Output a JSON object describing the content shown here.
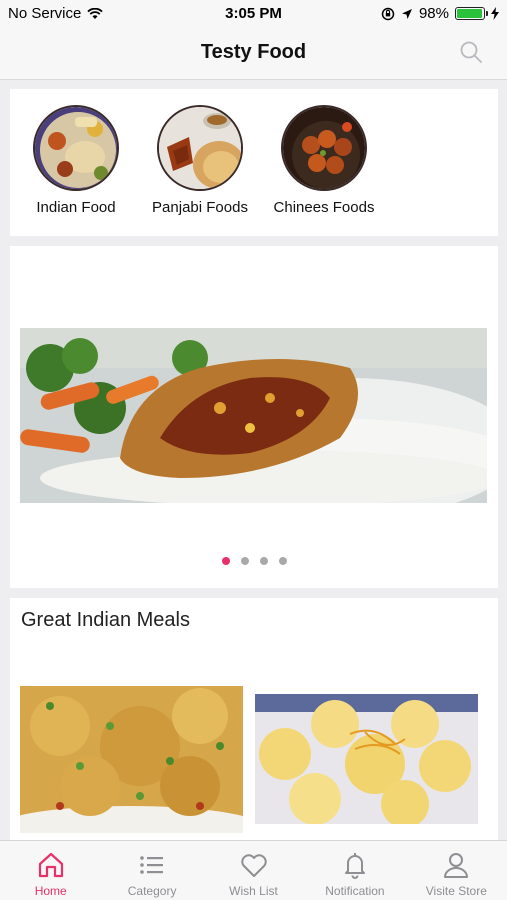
{
  "status_bar": {
    "carrier": "No Service",
    "time": "3:05 PM",
    "battery": "98%",
    "battery_level": 0.98
  },
  "header": {
    "title": "Testy Food",
    "search_icon": "search-icon"
  },
  "categories": [
    {
      "label": "Indian Food",
      "image": "indian-thali-image"
    },
    {
      "label": "Panjabi Foods",
      "image": "panjabi-food-image"
    },
    {
      "label": "Chinees Foods",
      "image": "chinese-food-image"
    }
  ],
  "banner": {
    "image": "chicken-rice-banner-image",
    "page_count": 4,
    "active_page": 1
  },
  "section": {
    "title": "Great Indian Meals",
    "items": [
      {
        "image": "vegetable-poha-image"
      },
      {
        "image": "rasgulla-sweets-image"
      }
    ]
  },
  "tabs": [
    {
      "label": "Home",
      "icon": "home-icon",
      "active": true
    },
    {
      "label": "Category",
      "icon": "list-icon",
      "active": false
    },
    {
      "label": "Wish List",
      "icon": "heart-icon",
      "active": false
    },
    {
      "label": "Notification",
      "icon": "bell-icon",
      "active": false
    },
    {
      "label": "Visite Store",
      "icon": "person-icon",
      "active": false
    }
  ],
  "colors": {
    "accent": "#e8316a",
    "inactive": "#8e8e93",
    "battery": "#2bc23b"
  }
}
